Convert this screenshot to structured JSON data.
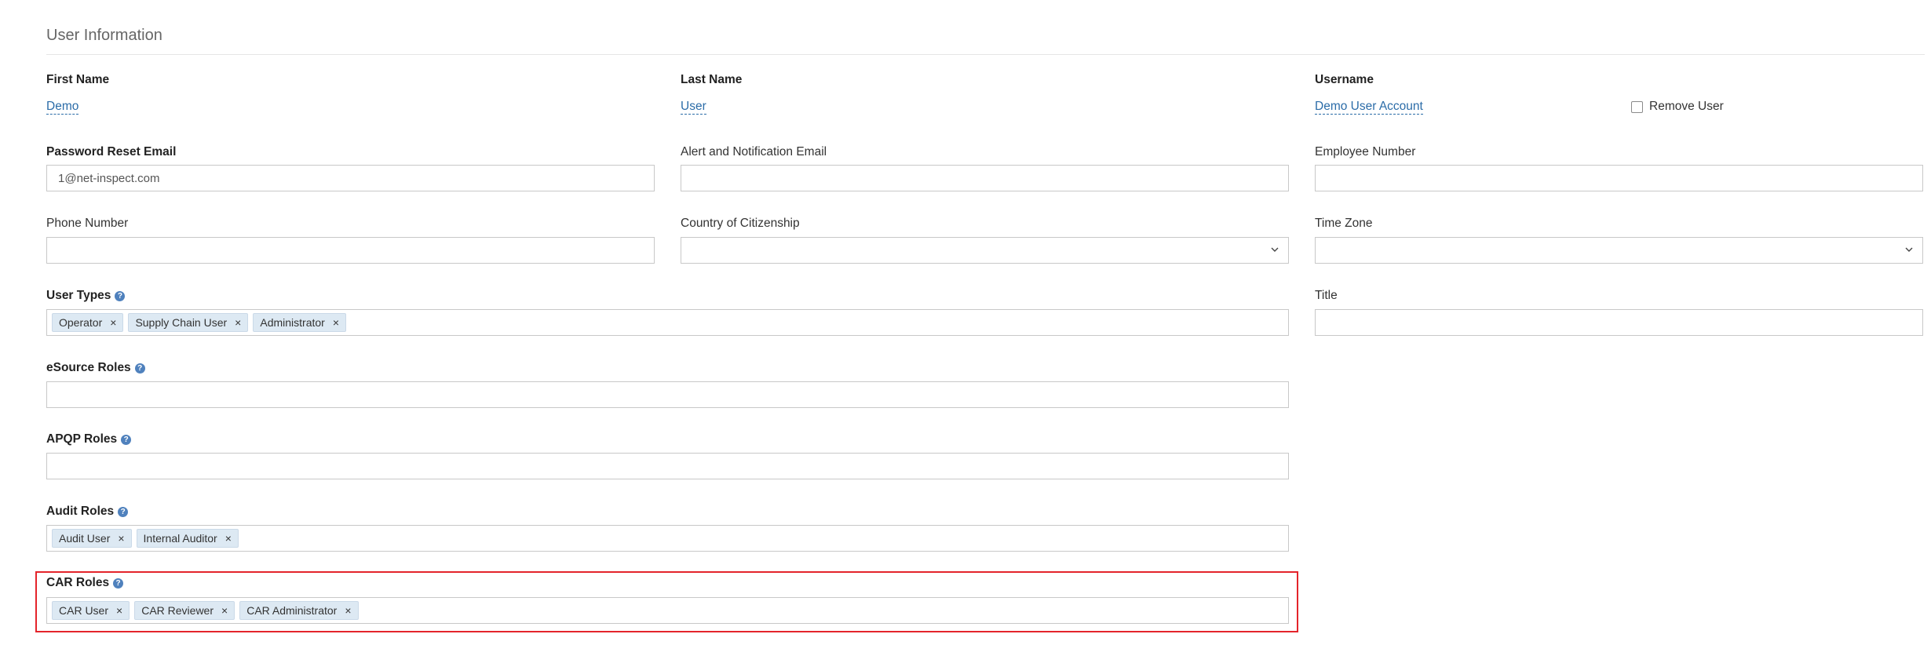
{
  "section": {
    "title": "User Information"
  },
  "first_name": {
    "label": "First Name",
    "value": "Demo"
  },
  "last_name": {
    "label": "Last Name",
    "value": "User"
  },
  "username": {
    "label": "Username",
    "value": "Demo User Account",
    "remove_label": "Remove User"
  },
  "password_reset_email": {
    "label": "Password Reset Email",
    "value": "1@net-inspect.com"
  },
  "alert_email": {
    "label": "Alert and Notification Email",
    "value": ""
  },
  "employee_number": {
    "label": "Employee Number",
    "value": ""
  },
  "phone_number": {
    "label": "Phone Number",
    "value": ""
  },
  "country": {
    "label": "Country of Citizenship",
    "value": ""
  },
  "time_zone": {
    "label": "Time Zone",
    "value": ""
  },
  "user_types": {
    "label": "User Types",
    "tags": [
      "Operator",
      "Supply Chain User",
      "Administrator"
    ]
  },
  "title_field": {
    "label": "Title",
    "value": ""
  },
  "esource_roles": {
    "label": "eSource Roles",
    "tags": []
  },
  "apqp_roles": {
    "label": "APQP Roles",
    "tags": []
  },
  "audit_roles": {
    "label": "Audit Roles",
    "tags": [
      "Audit User",
      "Internal Auditor"
    ]
  },
  "car_roles": {
    "label": "CAR Roles",
    "tags": [
      "CAR User",
      "CAR Reviewer",
      "CAR Administrator"
    ]
  },
  "icons": {
    "help": "help-icon",
    "chevron": "chevron-down-icon",
    "remove": "remove-tag-icon"
  },
  "colors": {
    "link": "#2b6ca8",
    "help": "#4f81bd",
    "tag_bg": "#dde9f3",
    "highlight": "#e4242b"
  }
}
